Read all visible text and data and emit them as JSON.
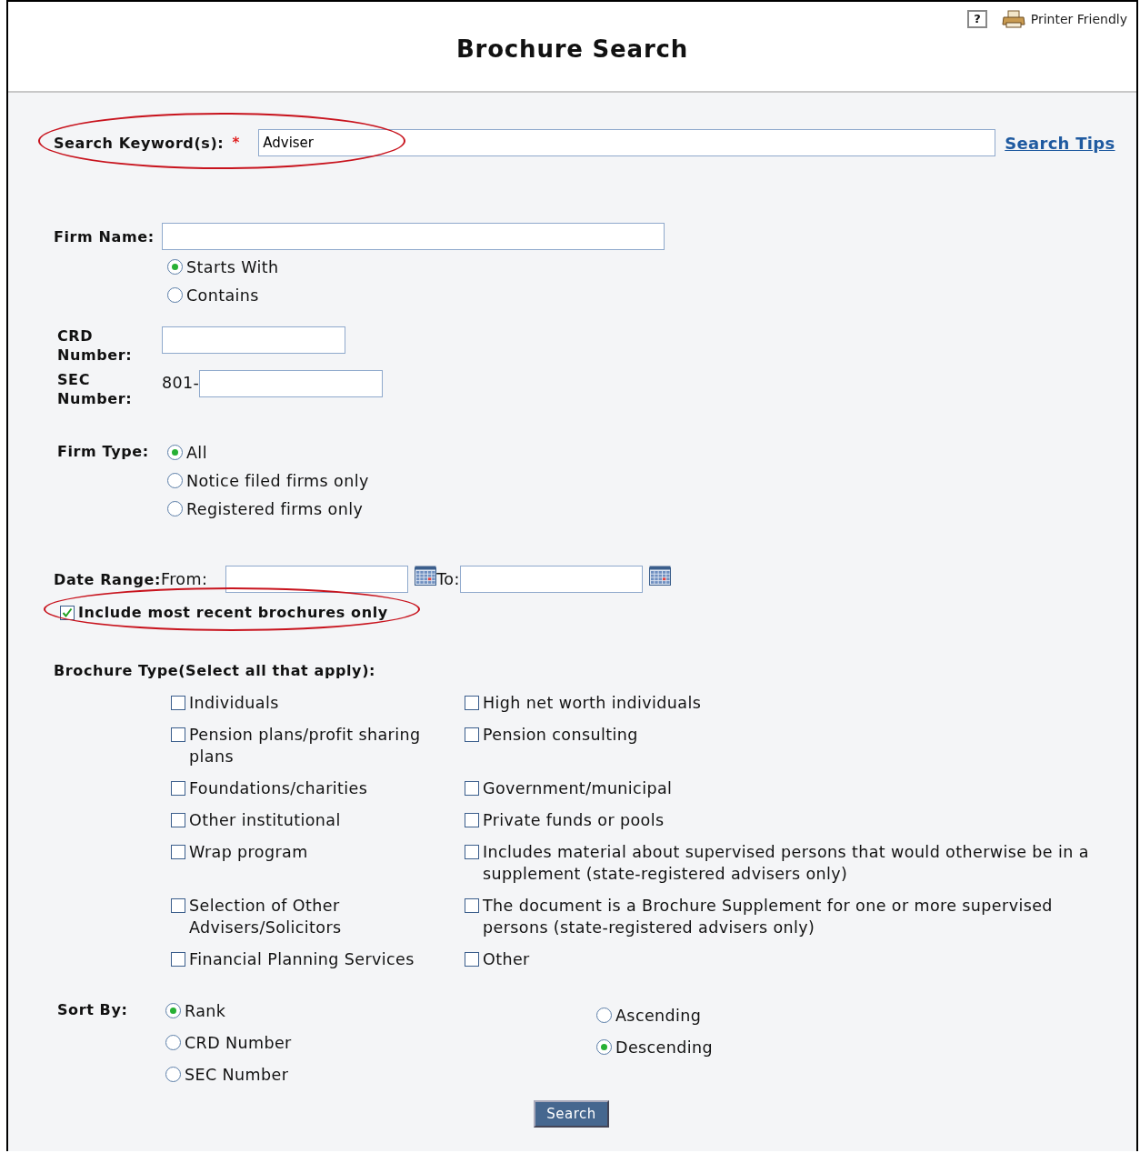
{
  "header": {
    "title": "Brochure Search",
    "help": "?",
    "printer_friendly": "Printer Friendly"
  },
  "keyword": {
    "label": "Search Keyword(s):",
    "required": "*",
    "value": "Adviser",
    "tips": "Search Tips",
    "highlighted": true
  },
  "firm_name": {
    "label": "Firm Name:",
    "options": [
      {
        "label": "Starts With",
        "selected": true
      },
      {
        "label": "Contains",
        "selected": false
      }
    ]
  },
  "crd_number": {
    "label": "CRD Number:"
  },
  "sec_number": {
    "label": "SEC Number:",
    "prefix": "801-"
  },
  "firm_type": {
    "label": "Firm Type:",
    "options": [
      {
        "label": "All",
        "selected": true
      },
      {
        "label": "Notice filed firms only",
        "selected": false
      },
      {
        "label": "Registered firms only",
        "selected": false
      }
    ]
  },
  "date_range": {
    "label": "Date Range:",
    "from": "From:",
    "to": "To:"
  },
  "recent_only": {
    "label": "Include most recent brochures only",
    "checked": true,
    "highlighted": true
  },
  "brochure_type": {
    "label": "Brochure Type(Select all that apply):",
    "options": [
      {
        "label": "Individuals",
        "checked": false
      },
      {
        "label": "High net worth individuals",
        "checked": false
      },
      {
        "label": "Pension plans/profit sharing plans",
        "checked": false
      },
      {
        "label": "Pension consulting",
        "checked": false
      },
      {
        "label": "Foundations/charities",
        "checked": false
      },
      {
        "label": "Government/municipal",
        "checked": false
      },
      {
        "label": "Other institutional",
        "checked": false
      },
      {
        "label": "Private funds or pools",
        "checked": false
      },
      {
        "label": "Wrap program",
        "checked": false
      },
      {
        "label": "Includes material about supervised persons that would otherwise be in a supplement (state-registered advisers only)",
        "checked": false
      },
      {
        "label": "Selection of Other Advisers/Solicitors",
        "checked": false
      },
      {
        "label": "The document is a Brochure Supplement for one or more supervised persons (state-registered advisers only)",
        "checked": false
      },
      {
        "label": "Financial Planning Services",
        "checked": false
      },
      {
        "label": "Other",
        "checked": false
      }
    ]
  },
  "sort_by": {
    "label": "Sort By:",
    "fields": [
      {
        "label": "Rank",
        "selected": true
      },
      {
        "label": "CRD Number",
        "selected": false
      },
      {
        "label": "SEC Number",
        "selected": false
      }
    ],
    "order": [
      {
        "label": "Ascending",
        "selected": false
      },
      {
        "label": "Descending",
        "selected": true
      }
    ]
  },
  "search_button": "Search"
}
